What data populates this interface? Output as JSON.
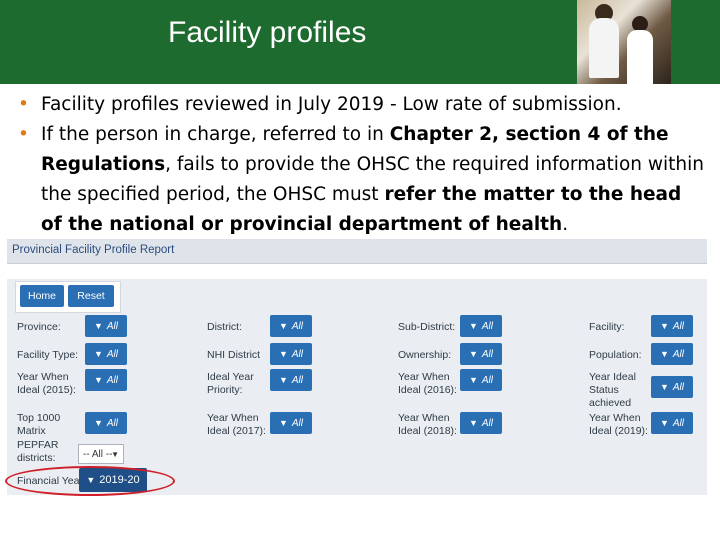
{
  "header": {
    "title": "Facility profiles",
    "photo_icon": "photo-nurses-children"
  },
  "bullets": [
    {
      "text": "Facility profiles reviewed in July 2019 - Low rate of submission."
    },
    {
      "t1": "If the person in charge, referred to in ",
      "b1": "Chapter 2, section 4 of the Regulations",
      "t2": ", fails to provide the OHSC the required information within the specified period, the OHSC must ",
      "b2": "refer the matter to the head of the national or provincial department of health",
      "t3": "."
    }
  ],
  "report": {
    "title": "Provincial Facility Profile Report",
    "buttons": {
      "home": "Home",
      "reset": "Reset"
    },
    "filters": {
      "province": {
        "label": "Province:",
        "value": "All"
      },
      "district": {
        "label": "District:",
        "value": "All"
      },
      "sub_district": {
        "label": "Sub-District:",
        "value": "All"
      },
      "facility": {
        "label": "Facility:",
        "value": "All"
      },
      "facility_type": {
        "label": "Facility Type:",
        "value": "All"
      },
      "nhi_district": {
        "label": "NHI District",
        "value": "All"
      },
      "ownership": {
        "label": "Ownership:",
        "value": "All"
      },
      "population": {
        "label": "Population:",
        "value": "All"
      },
      "ideal_2015": {
        "label_line1": "Year When",
        "label_line2": "Ideal (2015):",
        "value": "All"
      },
      "ideal_priority": {
        "label_line1": "Ideal Year",
        "label_line2": "Priority:",
        "value": "All"
      },
      "ideal_2016": {
        "label_line1": "Year When",
        "label_line2": "Ideal (2016):",
        "value": "All"
      },
      "ideal_status": {
        "label_line1": "Year Ideal",
        "label_line2": "Status",
        "label_line3": "achieved",
        "value": "All"
      },
      "top1000": {
        "label_line1": "Top 1000",
        "label_line2": "Matrix",
        "value": "All"
      },
      "ideal_2017": {
        "label_line1": "Year When",
        "label_line2": "Ideal (2017):",
        "value": "All"
      },
      "ideal_2018": {
        "label_line1": "Year When",
        "label_line2": "Ideal (2018):",
        "value": "All"
      },
      "ideal_2019": {
        "label_line1": "Year When",
        "label_line2": "Ideal (2019):",
        "value": "All"
      },
      "pepfar": {
        "label_line1": "PEPFAR",
        "label_line2": "districts:",
        "value": "-- All --"
      },
      "financial_year": {
        "label": "Financial Year",
        "value": "2019-20"
      }
    },
    "highlight_color": "#d01f2a",
    "button_color": "#2a6fb3"
  }
}
